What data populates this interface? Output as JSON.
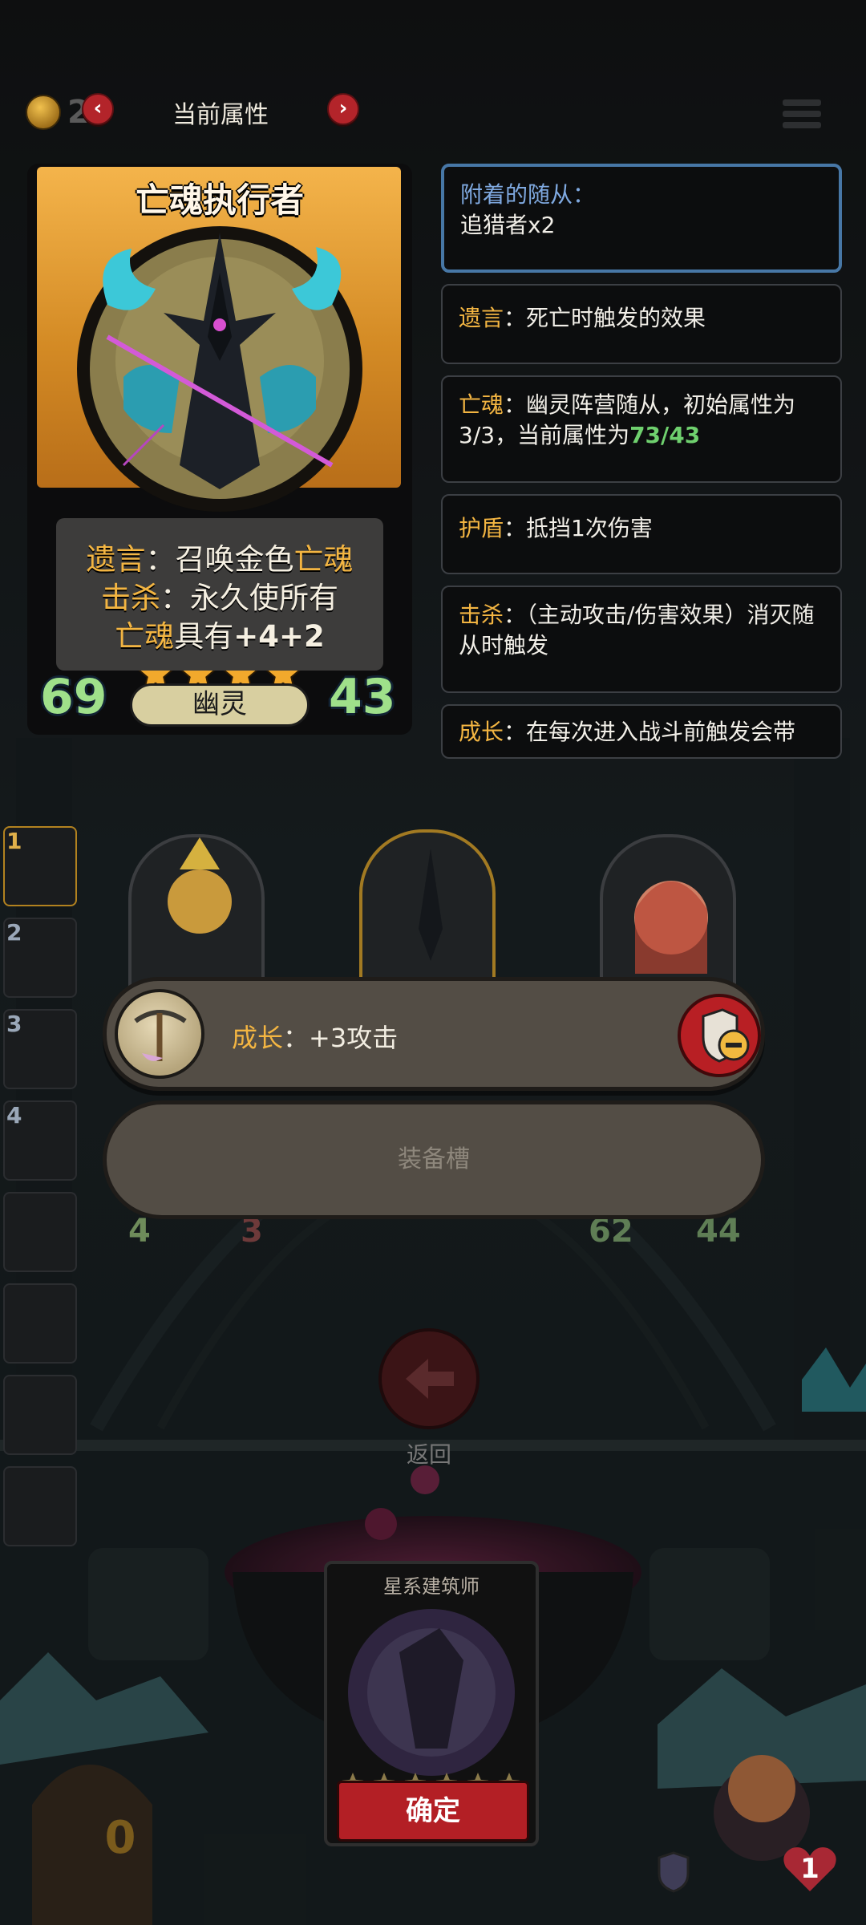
{
  "top_bar": {
    "coin_count": "2",
    "title": "当前属性",
    "prev_arrow": "‹",
    "next_arrow": "›"
  },
  "card": {
    "name": "亡魂执行者",
    "desc_line1_kw": "遗言",
    "desc_line1_rest": "：召唤金色",
    "desc_line1_kw2": "亡魂",
    "desc_line2_kw": "击杀",
    "desc_line2_rest": "：永久使所有",
    "desc_line3_kw": "亡魂",
    "desc_line3_rest": "具有",
    "desc_line3_bonus": "+4+2",
    "attack": "69",
    "health": "43",
    "tribe": "幽灵",
    "stars": 4
  },
  "tooltips": {
    "attached": {
      "label": "附着的随从：",
      "value": "追猎者x2"
    },
    "deathrattle": {
      "kw": "遗言",
      "text": "：死亡时触发的效果"
    },
    "ghost": {
      "kw": "亡魂",
      "text1": "：幽灵阵营随从，初始属性为",
      "text2": "3/3，当前属性为",
      "current": "73/43"
    },
    "shield": {
      "kw": "护盾",
      "text": "：抵挡1次伤害"
    },
    "kill": {
      "kw": "击杀",
      "text": "：（主动攻击/伤害效果）消灭随从时触发"
    },
    "growth": {
      "kw": "成长",
      "text": "：在每次进入战斗前触发会带"
    }
  },
  "board": {
    "side_slots": [
      "1",
      "2",
      "3",
      "4",
      "",
      "",
      "",
      ""
    ],
    "minion_left_stats": [
      "4",
      "3"
    ],
    "minion_right_stats": [
      "62",
      "44"
    ]
  },
  "equipment": {
    "item_kw": "成长",
    "item_text": "：+3攻击",
    "empty_slot_label": "装备槽"
  },
  "back_button": {
    "label": "返回"
  },
  "bottom": {
    "card_name": "星系建筑师",
    "stars": 6,
    "confirm_label": "确定",
    "gold": "0",
    "lives": "1"
  },
  "colors": {
    "keyword": "#f3b542",
    "highlight_green": "#6fd06e",
    "tooltip_blue": "#4777a6",
    "button_red": "#b31f25"
  }
}
